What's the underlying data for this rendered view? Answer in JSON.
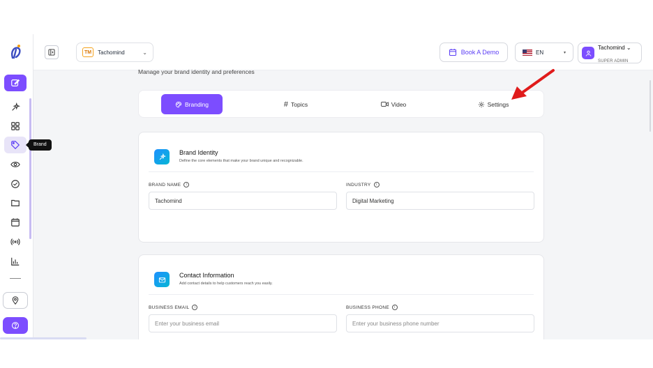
{
  "workspace": {
    "badge": "TM",
    "name": "Tachomind",
    "chevron": "⌄"
  },
  "header": {
    "book_demo_label": "Book A Demo",
    "language": "EN",
    "language_caret": "▾",
    "user_name": "Tachomind",
    "user_chevron": "⌄",
    "user_role": "SUPER ADMIN"
  },
  "sidebar": {
    "tooltip": "Brand",
    "items": [
      {
        "icon": "edit-icon",
        "active": true
      },
      {
        "icon": "sparkles-icon"
      },
      {
        "icon": "grid-icon"
      },
      {
        "icon": "tag-icon",
        "hover": true
      },
      {
        "icon": "eye-icon"
      },
      {
        "icon": "check-circle-icon"
      },
      {
        "icon": "folder-icon"
      },
      {
        "icon": "calendar-icon"
      },
      {
        "icon": "broadcast-icon"
      },
      {
        "icon": "bar-chart-icon"
      }
    ],
    "bottom": [
      {
        "icon": "location-pin-icon"
      },
      {
        "icon": "help-icon"
      }
    ]
  },
  "page": {
    "subtitle": "Manage your brand identity and preferences"
  },
  "tabs": [
    {
      "label": "Branding",
      "icon": "palette-icon",
      "active": true
    },
    {
      "label": "Topics",
      "icon": "hash-icon",
      "prefix": "#"
    },
    {
      "label": "Video",
      "icon": "video-icon"
    },
    {
      "label": "Settings",
      "icon": "gear-icon"
    }
  ],
  "brand_identity": {
    "title": "Brand Identity",
    "description": "Define the core elements that make your brand unique and recognizable.",
    "brand_name_label": "BRAND NAME",
    "brand_name_value": "Tachomind",
    "industry_label": "INDUSTRY",
    "industry_value": "Digital Marketing"
  },
  "contact": {
    "title": "Contact Information",
    "description": "Add contact details to help customers reach you easily.",
    "email_label": "BUSINESS EMAIL",
    "email_placeholder": "Enter your business email",
    "phone_label": "BUSINESS PHONE",
    "phone_placeholder": "Enter your business phone number"
  },
  "info_glyph": "i",
  "colors": {
    "accent": "#7c4dff",
    "annotation_arrow": "#e01b1b",
    "info_tile": "#1e90ff"
  }
}
